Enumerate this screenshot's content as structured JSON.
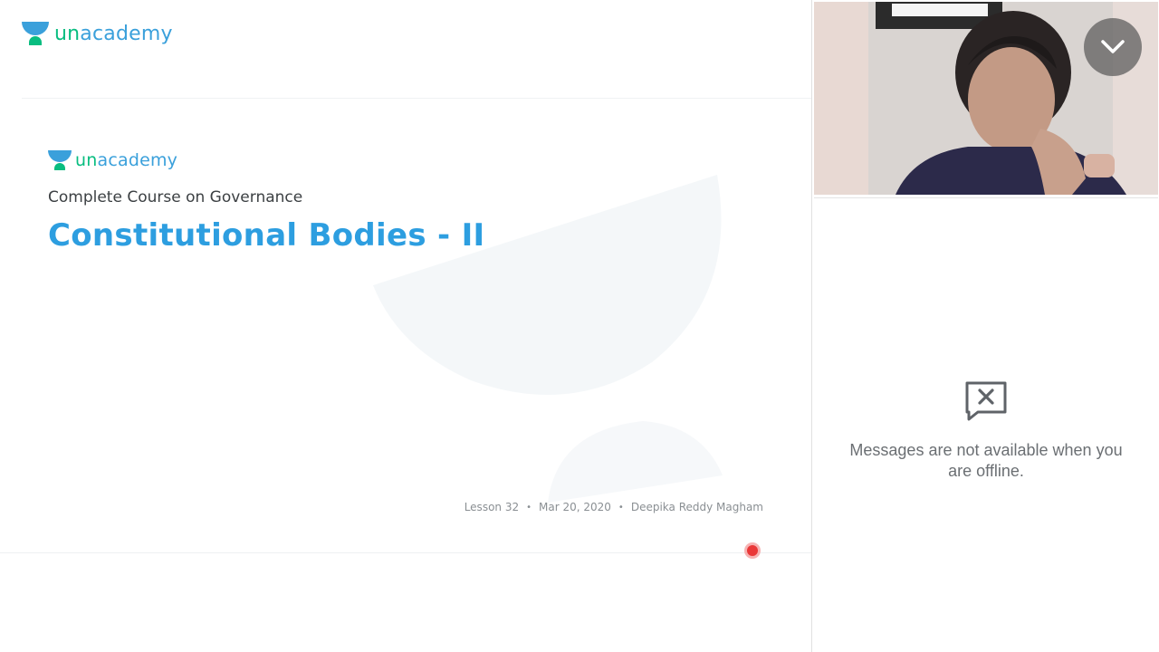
{
  "brand": {
    "name_blue": "unacademy",
    "color_blue": "#3aa0db",
    "color_green": "#08bd80"
  },
  "slide": {
    "brand_name": "unacademy",
    "course_subtitle": "Complete Course on Governance",
    "lesson_title": "Constitutional Bodies - II",
    "lesson_number": "Lesson 32",
    "date": "Mar 20, 2020",
    "educator": "Deepika Reddy Magham",
    "title_color": "#2d9ee0"
  },
  "recording_indicator": {
    "icon": "record-dot-icon",
    "color": "#ea3838"
  },
  "video": {
    "collapse_icon": "chevron-down-icon"
  },
  "chat": {
    "offline_icon": "message-unavailable-icon",
    "offline_message": "Messages are not available when you are offline."
  }
}
